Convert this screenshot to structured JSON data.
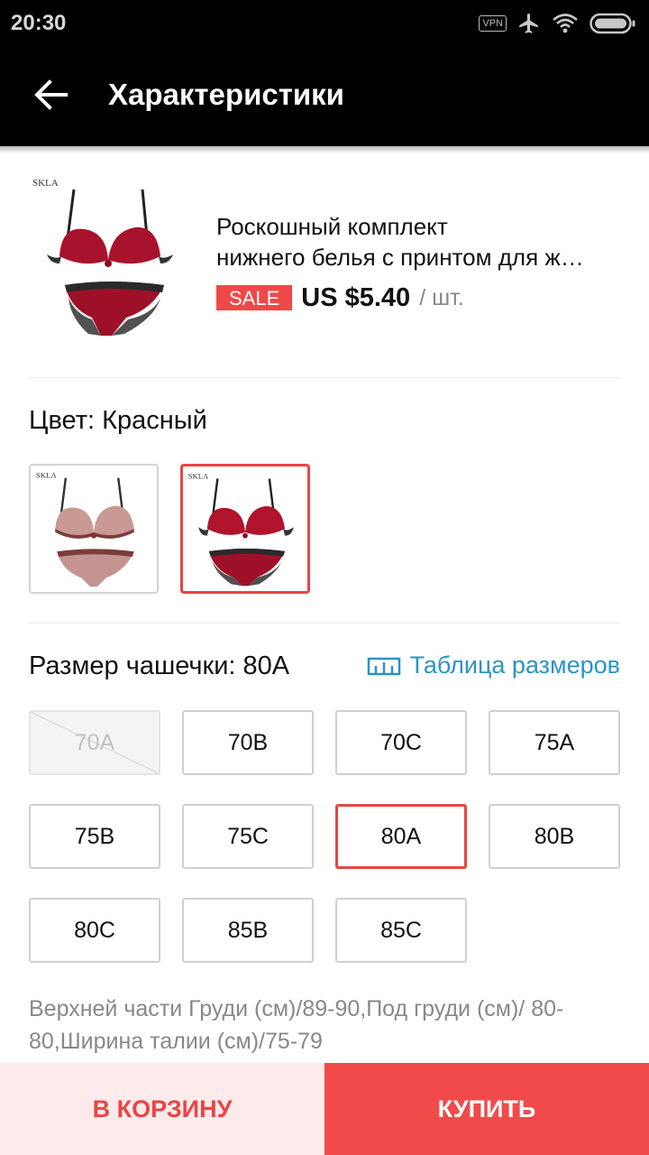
{
  "status_bar": {
    "time": "20:30",
    "vpn_label": "VPN",
    "icons": [
      "vpn-badge",
      "airplane-icon",
      "wifi-icon",
      "battery-icon"
    ]
  },
  "app_bar": {
    "back_icon": "arrow-left-icon",
    "title": "Характеристики"
  },
  "product": {
    "title_line1": "Роскошный комплект",
    "title_line2": "нижнего белья с принтом для ж…",
    "sale_label": "SALE",
    "price": "US $5.40",
    "unit": "/ шт.",
    "image_brand_text": "SKLA"
  },
  "color_section": {
    "label": "Цвет: Красный",
    "options": [
      {
        "name": "pink-print",
        "selected": false,
        "color": "#c99a94"
      },
      {
        "name": "red",
        "selected": true,
        "color": "#b0142c"
      }
    ]
  },
  "size_section": {
    "label": "Размер чашечки: 80A",
    "size_chart_label": "Таблица размеров",
    "sizes": [
      {
        "label": "70A",
        "state": "disabled"
      },
      {
        "label": "70B",
        "state": "normal"
      },
      {
        "label": "70C",
        "state": "normal"
      },
      {
        "label": "75A",
        "state": "normal"
      },
      {
        "label": "75B",
        "state": "normal"
      },
      {
        "label": "75C",
        "state": "normal"
      },
      {
        "label": "80A",
        "state": "selected"
      },
      {
        "label": "80B",
        "state": "normal"
      },
      {
        "label": "80C",
        "state": "normal"
      },
      {
        "label": "85B",
        "state": "normal"
      },
      {
        "label": "85C",
        "state": "normal"
      }
    ]
  },
  "spec_text": "Верхней части Груди (см)/89-90,Под груди (см)/ 80-80,Ширина талии (см)/75-79",
  "bottom_bar": {
    "cart_label": "В КОРЗИНУ",
    "buy_label": "КУПИТЬ"
  },
  "colors": {
    "accent": "#e84545",
    "buy_button": "#f24a4a",
    "cart_button_bg": "#fdeaea",
    "link": "#2b94c4"
  }
}
